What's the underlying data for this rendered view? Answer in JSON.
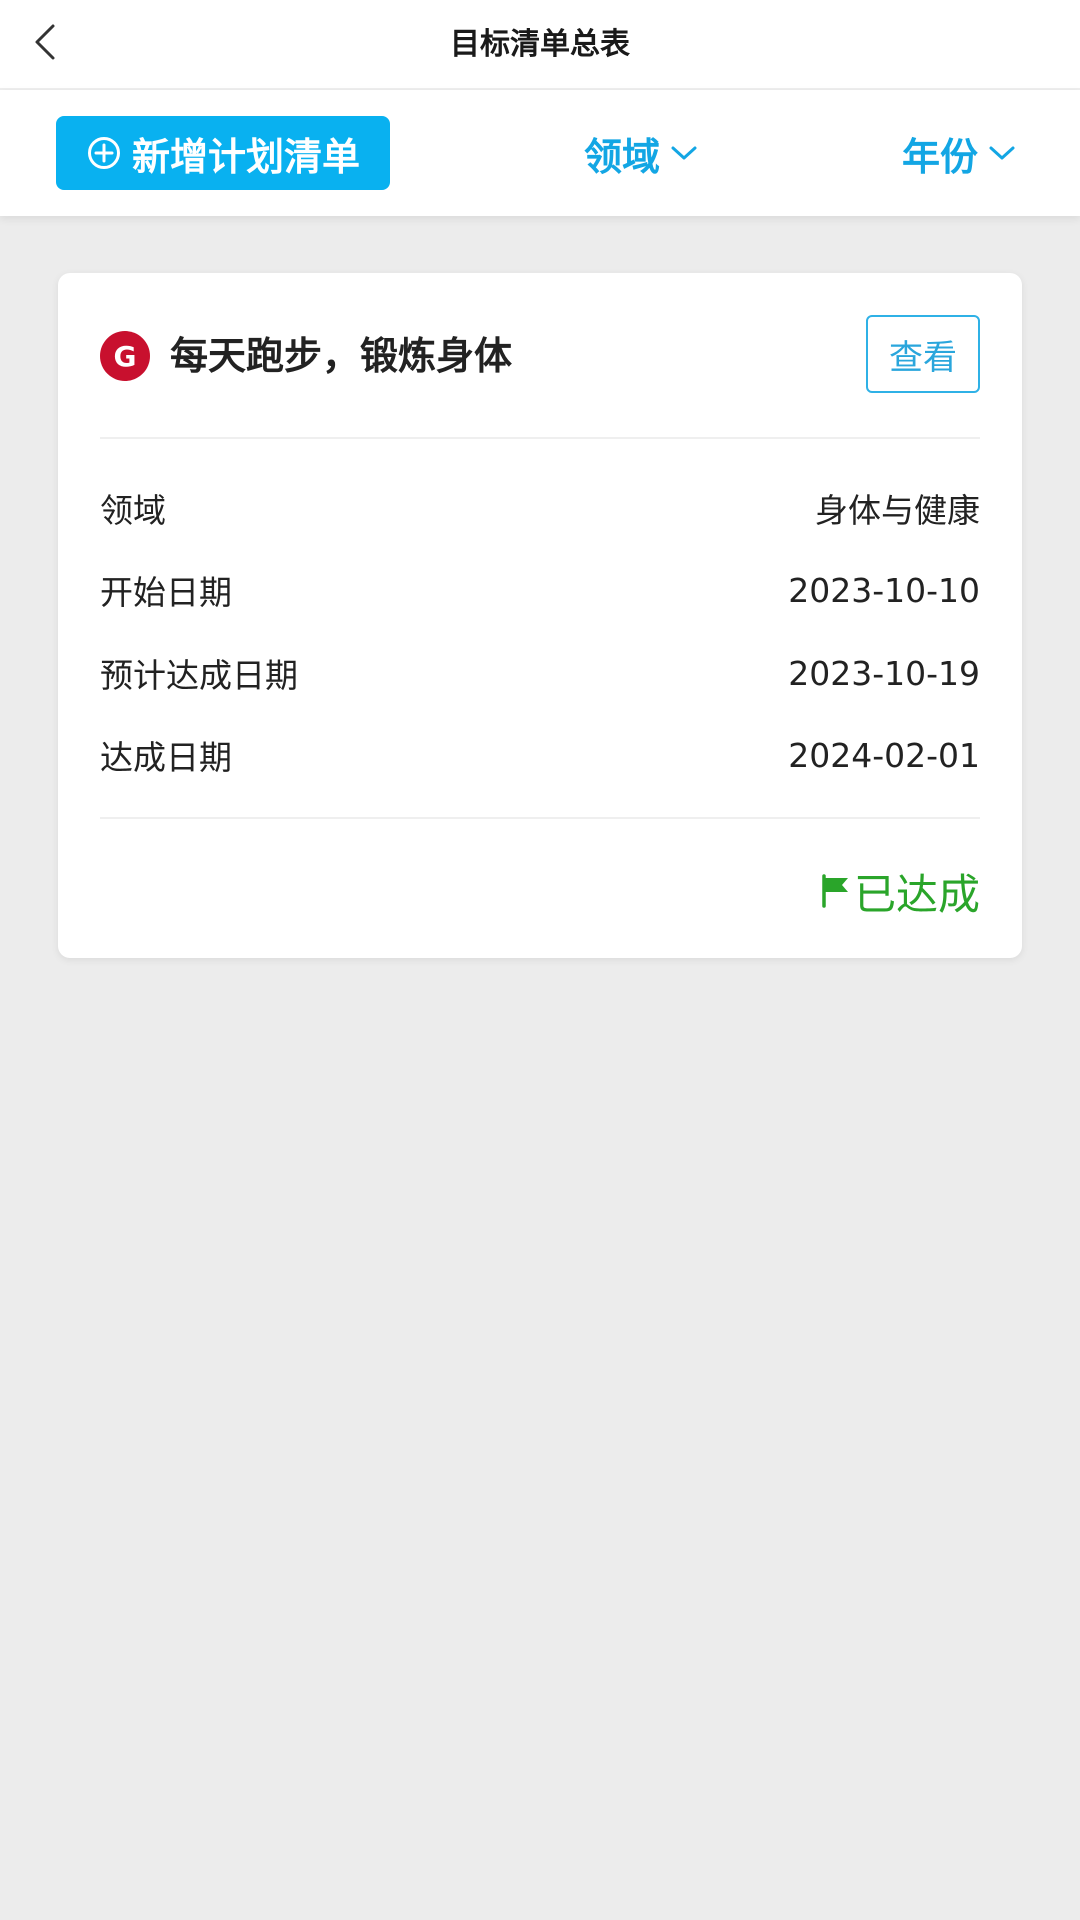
{
  "navbar": {
    "title": "目标清单总表",
    "back_icon": "chevron-left-icon"
  },
  "toolbar": {
    "add_plan_label": "新增计划清单",
    "add_plan_icon": "plus-circle-icon",
    "filter_domain_label": "领域",
    "filter_year_label": "年份",
    "filter_icon": "chevron-down-icon"
  },
  "goal_card": {
    "badge_letter": "G",
    "title": "每天跑步，锻炼身体",
    "view_label": "查看",
    "details": [
      {
        "label": "领域",
        "value": "身体与健康"
      },
      {
        "label": "开始日期",
        "value": "2023-10-10"
      },
      {
        "label": "预计达成日期",
        "value": "2023-10-19"
      },
      {
        "label": "达成日期",
        "value": "2024-02-01"
      }
    ],
    "status_label": "已达成",
    "status_icon": "flag-icon"
  },
  "colors": {
    "accent": "#09b1f0",
    "filter_text": "#13a6e4",
    "badge": "#c8102e",
    "status_green": "#2aa52a",
    "background": "#ececec"
  }
}
